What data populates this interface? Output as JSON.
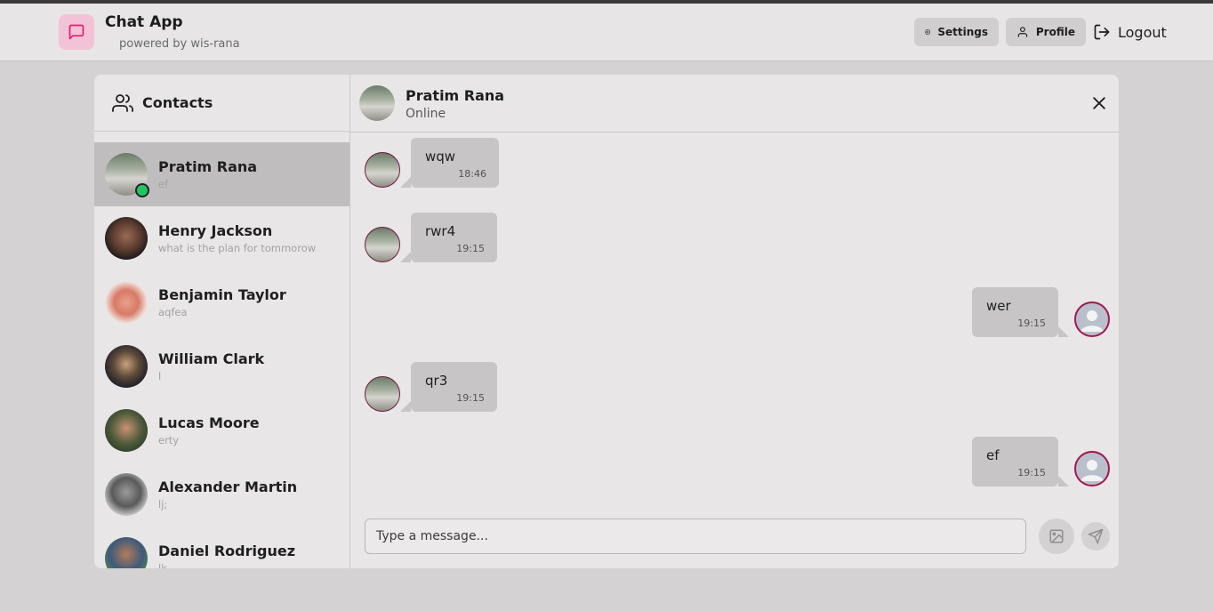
{
  "app": {
    "title": "Chat App",
    "subtitle": "powered by wis-rana"
  },
  "nav": {
    "settings_label": "Settings",
    "profile_label": "Profile",
    "logout_label": "Logout"
  },
  "sidebar": {
    "title": "Contacts",
    "contacts": [
      {
        "name": "Pratim Rana",
        "last": "ef",
        "online": true,
        "active": true
      },
      {
        "name": "Henry Jackson",
        "last": "what is the plan for tommorow"
      },
      {
        "name": "Benjamin Taylor",
        "last": "aqfea"
      },
      {
        "name": "William Clark",
        "last": "l"
      },
      {
        "name": "Lucas Moore",
        "last": "erty"
      },
      {
        "name": "Alexander Martin",
        "last": "lj;"
      },
      {
        "name": "Daniel Rodriguez",
        "last": "lk"
      }
    ]
  },
  "chat": {
    "name": "Pratim Rana",
    "status": "Online",
    "messages": [
      {
        "text": "wqw",
        "time": "18:46",
        "from": "them"
      },
      {
        "text": "rwr4",
        "time": "19:15",
        "from": "them"
      },
      {
        "text": "wer",
        "time": "19:15",
        "from": "me"
      },
      {
        "text": "qr3",
        "time": "19:15",
        "from": "them"
      },
      {
        "text": "ef",
        "time": "19:15",
        "from": "me"
      }
    ],
    "input_placeholder": "Type a message..."
  },
  "colors": {
    "accent": "#e11d74",
    "logo_bg": "#f2c3d6",
    "online": "#22c55e",
    "self_ring": "#a3174f"
  },
  "icons": [
    "message-square-icon",
    "gear-icon",
    "user-icon",
    "logout-icon",
    "users-icon",
    "close-icon",
    "image-icon",
    "send-icon"
  ]
}
